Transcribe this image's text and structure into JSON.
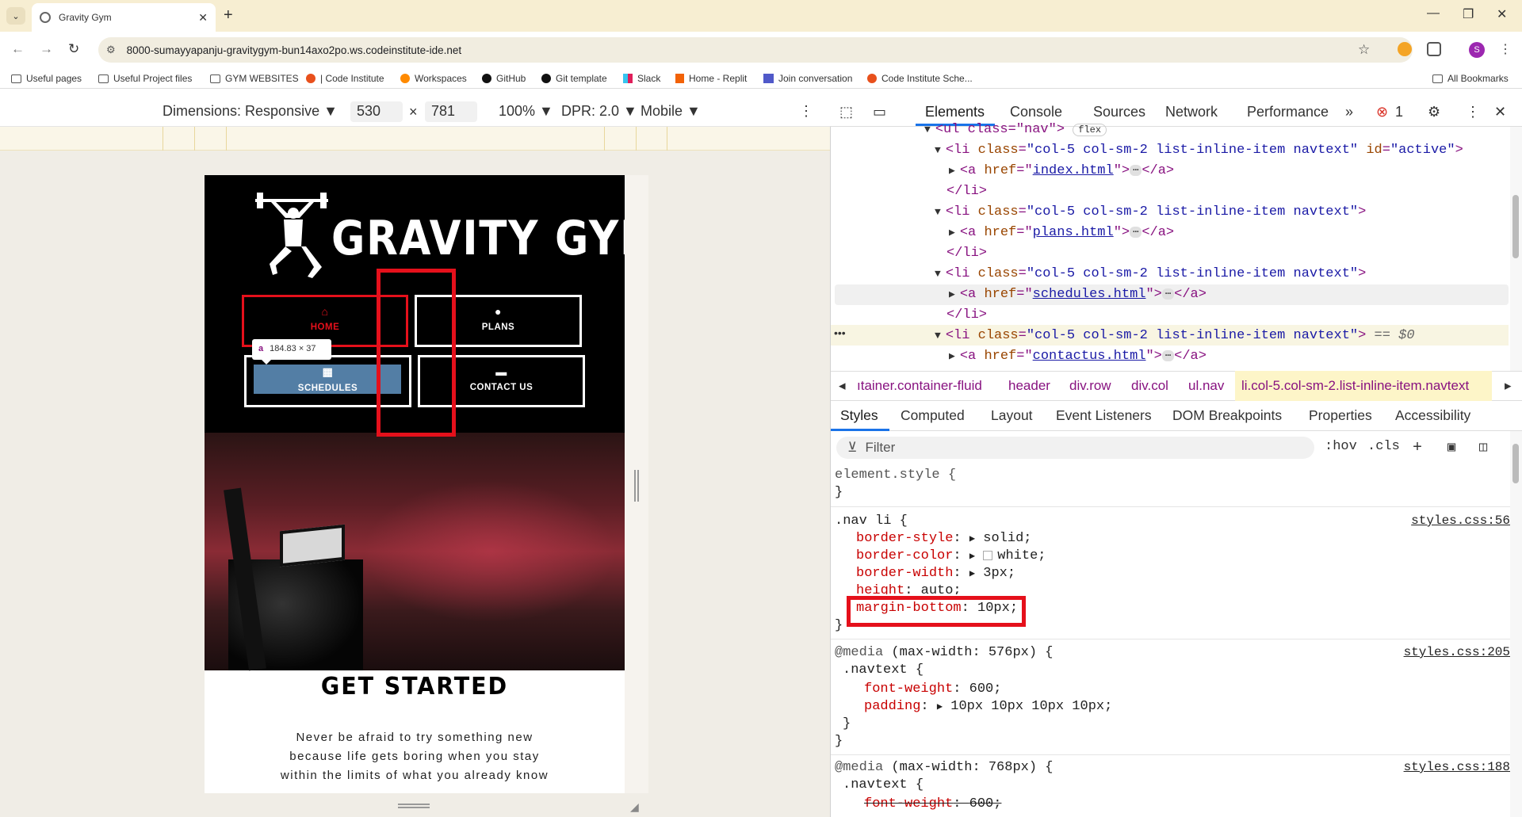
{
  "browser": {
    "tab_title": "Gravity Gym",
    "url": "8000-sumayyapanju-gravitygym-bun14axo2po.ws.codeinstitute-ide.net",
    "profile_initial": "S",
    "bookmarks": [
      {
        "label": "Useful pages",
        "icon": "folder-icon"
      },
      {
        "label": "Useful Project files",
        "icon": "folder-icon"
      },
      {
        "label": "GYM WEBSITES",
        "icon": "folder-icon"
      },
      {
        "label": "| Code Institute",
        "icon": "code-institute-icon"
      },
      {
        "label": "Workspaces",
        "icon": "gitpod-icon"
      },
      {
        "label": "GitHub",
        "icon": "github-icon"
      },
      {
        "label": "Git template",
        "icon": "github-icon"
      },
      {
        "label": "Slack",
        "icon": "slack-icon"
      },
      {
        "label": "Home - Replit",
        "icon": "replit-icon"
      },
      {
        "label": "Join conversation",
        "icon": "teams-icon"
      },
      {
        "label": "Code Institute Sche...",
        "icon": "code-institute-icon"
      }
    ],
    "all_bookmarks": "All Bookmarks"
  },
  "device_toolbar": {
    "dimensions": "Dimensions: Responsive ▼",
    "width": "530",
    "times": "×",
    "height": "781",
    "zoom": "100% ▼",
    "dpr": "DPR: 2.0 ▼",
    "mode": "Mobile ▼"
  },
  "site": {
    "logo_text": "GRAVITY GYM",
    "nav": {
      "home": "HOME",
      "plans": "PLANS",
      "schedules": "SCHEDULES",
      "contact": "CONTACT US"
    },
    "tooltip_tag": "a",
    "tooltip_size": "184.83 × 37",
    "get_started": "GET STARTED",
    "intro": "Never be afraid to try something new because life gets boring when you stay within the limits of what you already know"
  },
  "devtools": {
    "tabs": [
      "Elements",
      "Console",
      "Sources",
      "Network",
      "Performance",
      "»"
    ],
    "error_count": "1",
    "dom": {
      "line0": "<ul class=\"nav\">",
      "flex_badge": "flex",
      "li_open": "<li ",
      "li_class_attr": "class",
      "li_class_val": "\"col-5 col-sm-2 list-inline-item navtext\"",
      "id_attr": "id",
      "id_val": "\"active\"",
      "href_attr": "href",
      "href1": "index.html",
      "href2": "plans.html",
      "href3": "schedules.html",
      "href4": "contactus.html",
      "li_close": "</li>",
      "a_close": "</a>",
      "ellipsis": "⋯",
      "selected_marker": "== $0"
    },
    "breadcrumbs": [
      "ıtainer.container-fluid",
      "header",
      "div.row",
      "div.col",
      "ul.nav",
      "li.col-5.col-sm-2.list-inline-item.navtext"
    ],
    "style_tabs": [
      "Styles",
      "Computed",
      "Layout",
      "Event Listeners",
      "DOM Breakpoints",
      "Properties",
      "Accessibility"
    ],
    "filter_placeholder": "Filter",
    "hov": ":hov",
    "cls": ".cls",
    "styles": {
      "element_style": "element.style {",
      "close": "}",
      "rule1_selector": ".nav li {",
      "rule1_src": "styles.css:56",
      "p_border_style": "border-style",
      "v_border_style": "solid;",
      "p_border_color": "border-color",
      "v_border_color": "white;",
      "p_border_width": "border-width",
      "v_border_width": "3px;",
      "p_height": "height",
      "v_height": "auto;",
      "p_margin_bottom": "margin-bottom",
      "v_margin_bottom": "10px;",
      "media1": "@media",
      "media1_cond": "(max-width: 576px) {",
      "media1_src": "styles.css:205",
      "navtext_sel": ".navtext {",
      "p_font_weight": "font-weight",
      "v_font_weight": "600;",
      "p_padding": "padding",
      "v_padding": "10px 10px 10px 10px;",
      "media2_cond": "(max-width: 768px) {",
      "media2_src": "styles.css:188"
    }
  },
  "colors": {
    "accent_red": "#e5101b",
    "devtools_blue": "#1a73e8"
  }
}
